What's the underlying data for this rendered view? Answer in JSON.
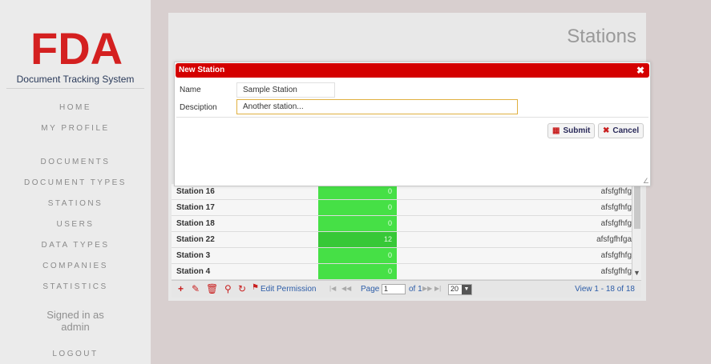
{
  "sidebar": {
    "logo": "FDA",
    "subtitle": "Document Tracking System",
    "nav": [
      {
        "label": "HOME"
      },
      {
        "label": "MY PROFILE"
      },
      {
        "label": "DOCUMENTS"
      },
      {
        "label": "DOCUMENT TYPES"
      },
      {
        "label": "STATIONS"
      },
      {
        "label": "USERS"
      },
      {
        "label": "DATA TYPES"
      },
      {
        "label": "COMPANIES"
      },
      {
        "label": "STATISTICS"
      }
    ],
    "signed_in_line1": "Signed in as",
    "signed_in_line2": "admin",
    "logout": "LOGOUT"
  },
  "main": {
    "title": "Stations",
    "rows": [
      {
        "name": "Station 16",
        "count": "0",
        "description": "afsfgfhfg"
      },
      {
        "name": "Station 17",
        "count": "0",
        "description": "afsfgfhfg"
      },
      {
        "name": "Station 18",
        "count": "0",
        "description": "afsfgfhfg"
      },
      {
        "name": "Station 22",
        "count": "12",
        "description": "afsfgfhfga"
      },
      {
        "name": "Station 3",
        "count": "0",
        "description": "afsfgfhfg"
      },
      {
        "name": "Station 4",
        "count": "0",
        "description": "afsfgfhfg"
      }
    ],
    "pager": {
      "edit_permission": "Edit Permission",
      "page_label": "Page",
      "page_value": "1",
      "of_label": "of 1",
      "rows_per_page": "20",
      "view_label": "View 1 - 18 of 18"
    }
  },
  "dialog": {
    "title": "New Station",
    "name_label": "Name",
    "name_value": "Sample Station",
    "description_label": "Desciption",
    "description_value": "Another station...",
    "submit_label": "Submit",
    "cancel_label": "Cancel"
  },
  "colors": {
    "brand_red": "#d42020",
    "dialog_header": "#d40000",
    "count_green": "#46e046"
  }
}
